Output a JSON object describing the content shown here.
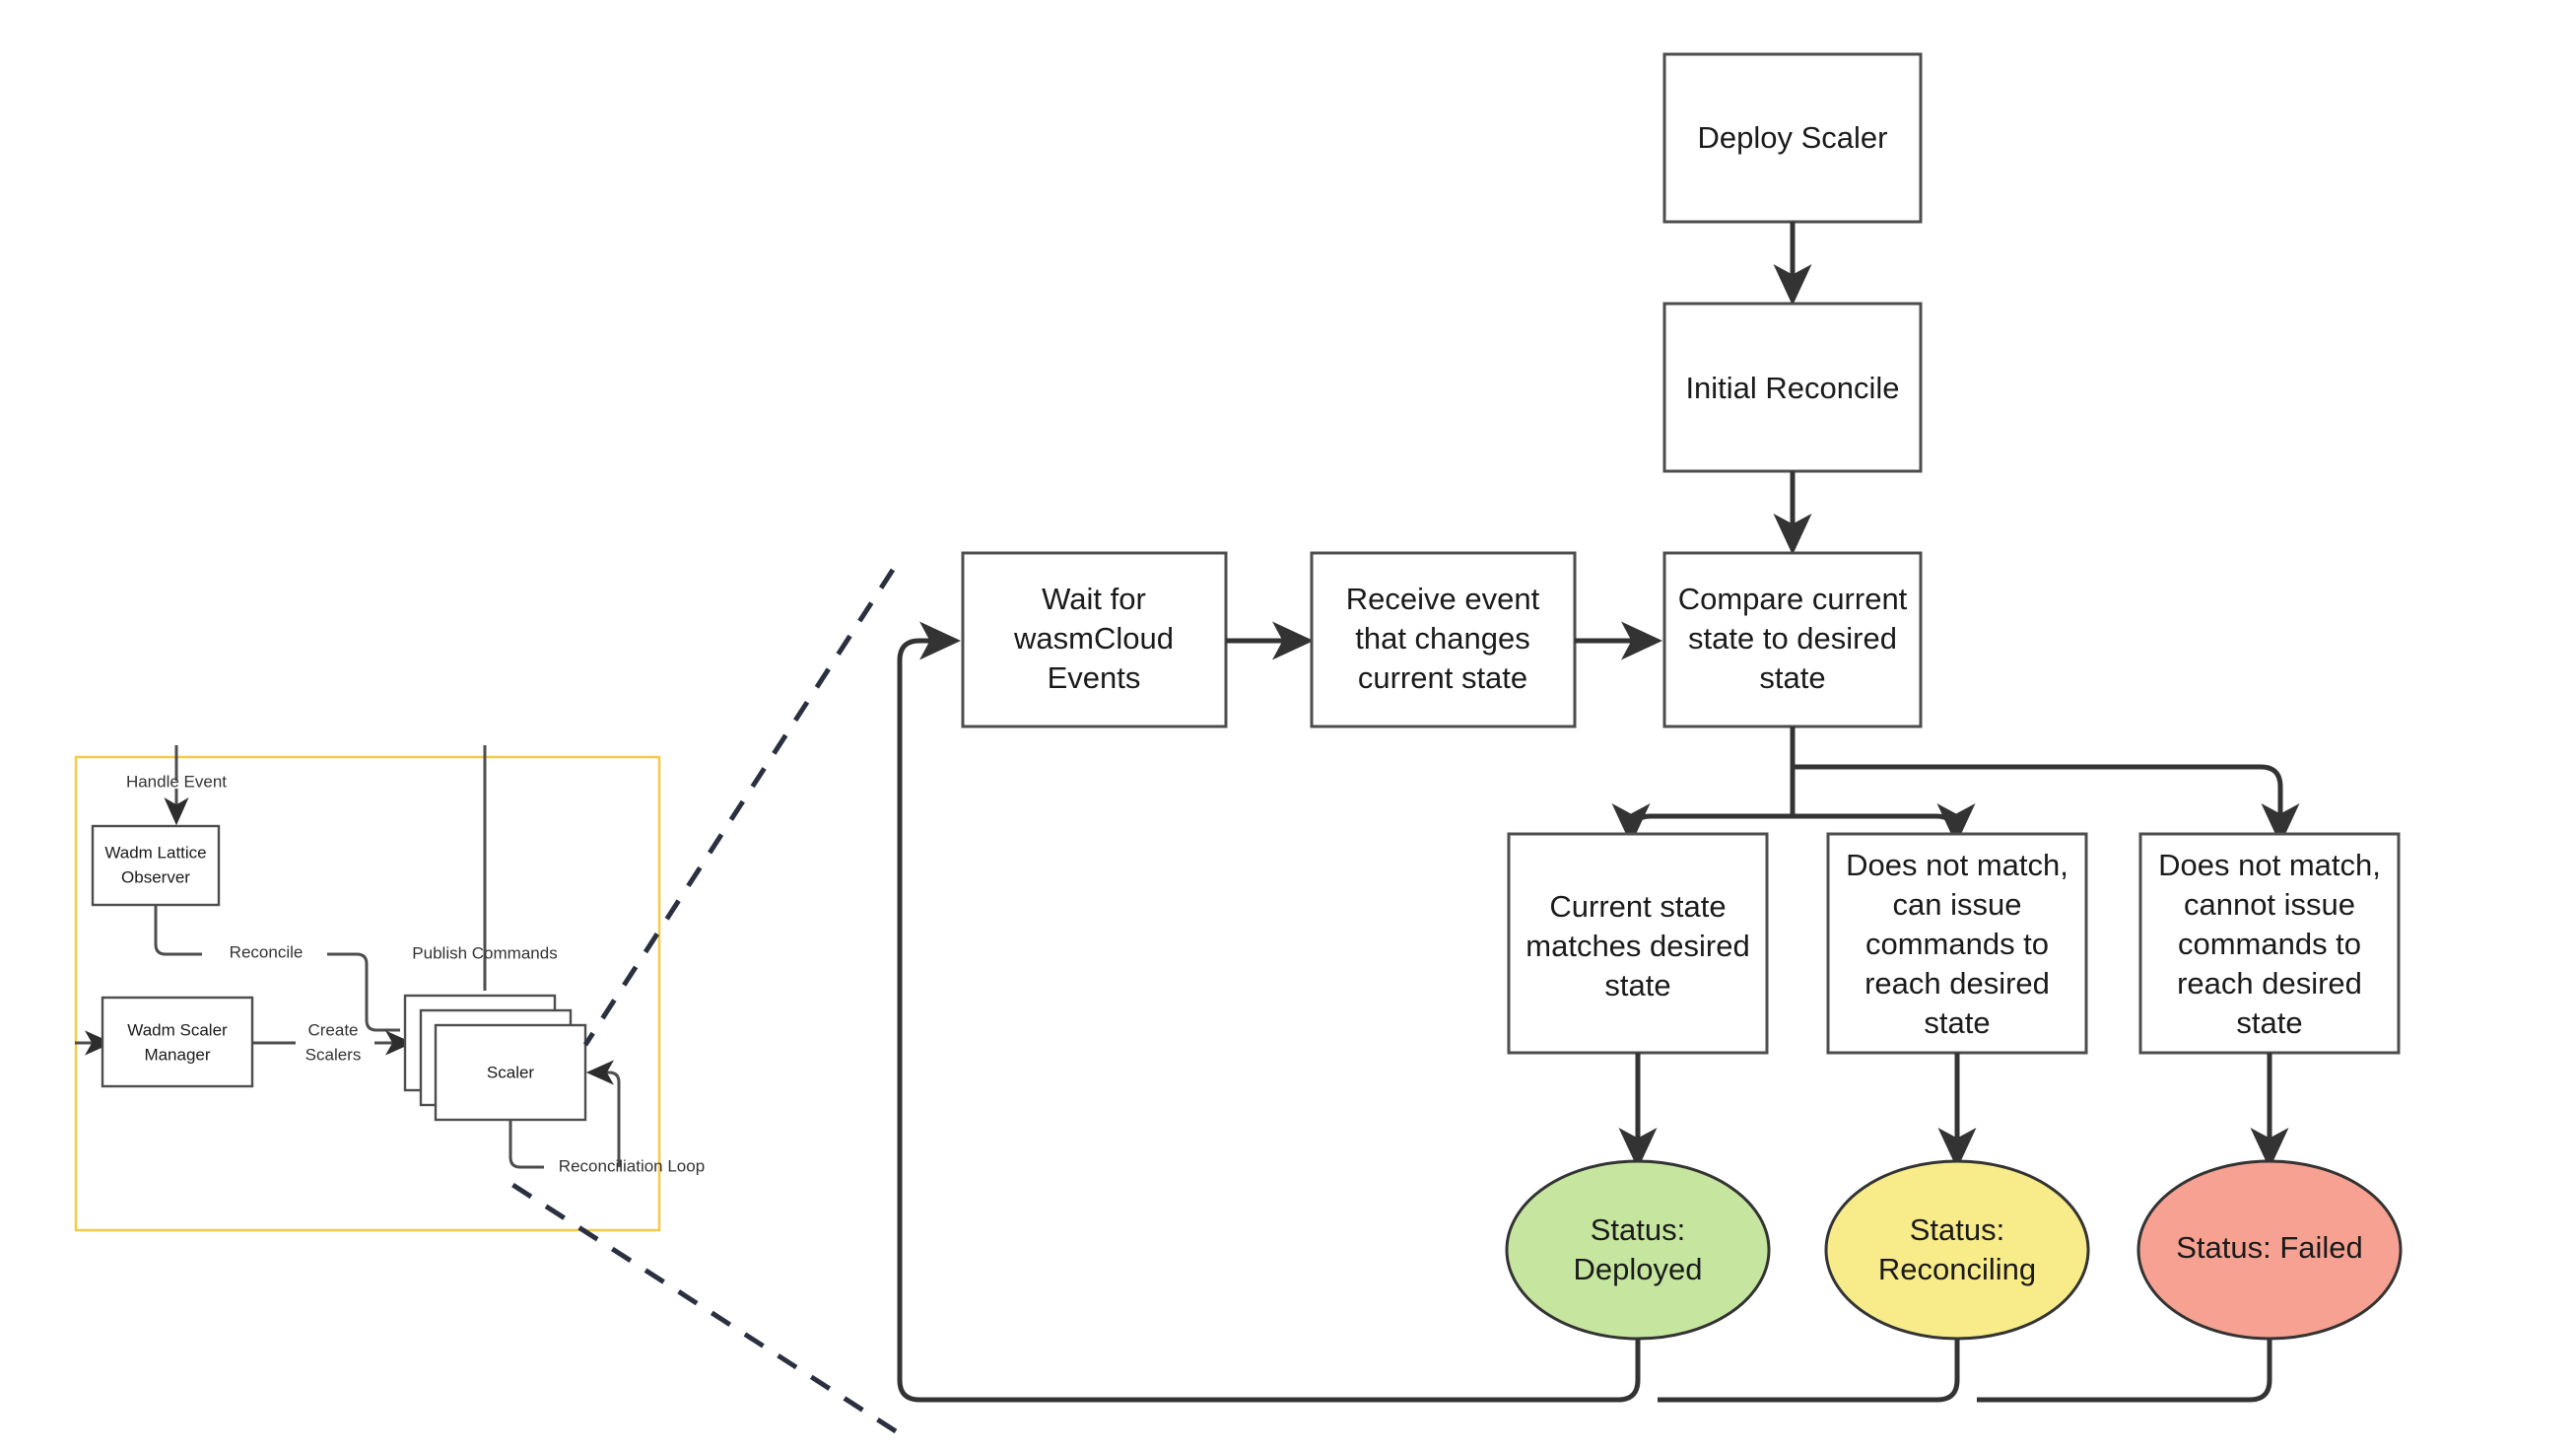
{
  "diagram": {
    "type": "flowchart",
    "title": "wadm Scaler reconciliation flow",
    "colors": {
      "node_stroke": "#4d4d4d",
      "edge_stroke": "#333333",
      "dashed_edge": "#2b3040",
      "group_border": "#f7ca45",
      "status_deployed_fill": "#c6e6a0",
      "status_reconciling_fill": "#f7eb8a",
      "status_failed_fill": "#f6a192",
      "node_fill": "#ffffff",
      "text": "#1a1a1a"
    }
  },
  "overview": {
    "group_label": "",
    "nodes": {
      "lattice_observer": "Wadm Lattice\nObserver",
      "lattice_observer_line1": "Wadm Lattice",
      "lattice_observer_line2": "Observer",
      "scaler_manager_line1": "Wadm Scaler",
      "scaler_manager_line2": "Manager",
      "scaler": "Scaler"
    },
    "edge_labels": {
      "handle_event": "Handle Event",
      "reconcile": "Reconcile",
      "create_scalers_line1": "Create",
      "create_scalers_line2": "Scalers",
      "publish_commands": "Publish Commands",
      "reconciliation_loop": "Reconciliation Loop"
    }
  },
  "detail": {
    "nodes": {
      "deploy_scaler": "Deploy Scaler",
      "initial_reconcile": "Initial Reconcile",
      "wait_events_line1": "Wait for",
      "wait_events_line2": "wasmCloud",
      "wait_events_line3": "Events",
      "receive_event_line1": "Receive event",
      "receive_event_line2": "that changes",
      "receive_event_line3": "current state",
      "compare_state_line1": "Compare current",
      "compare_state_line2": "state to desired",
      "compare_state_line3": "state",
      "matches_line1": "Current state",
      "matches_line2": "matches desired",
      "matches_line3": "state",
      "can_issue_line1": "Does not match,",
      "can_issue_line2": "can issue",
      "can_issue_line3": "commands to",
      "can_issue_line4": "reach desired",
      "can_issue_line5": "state",
      "cannot_issue_line1": "Does not match,",
      "cannot_issue_line2": "cannot issue",
      "cannot_issue_line3": "commands to",
      "cannot_issue_line4": "reach desired",
      "cannot_issue_line5": "state",
      "status_deployed_line1": "Status:",
      "status_deployed_line2": "Deployed",
      "status_reconciling_line1": "Status:",
      "status_reconciling_line2": "Reconciling",
      "status_failed": "Status: Failed"
    }
  }
}
